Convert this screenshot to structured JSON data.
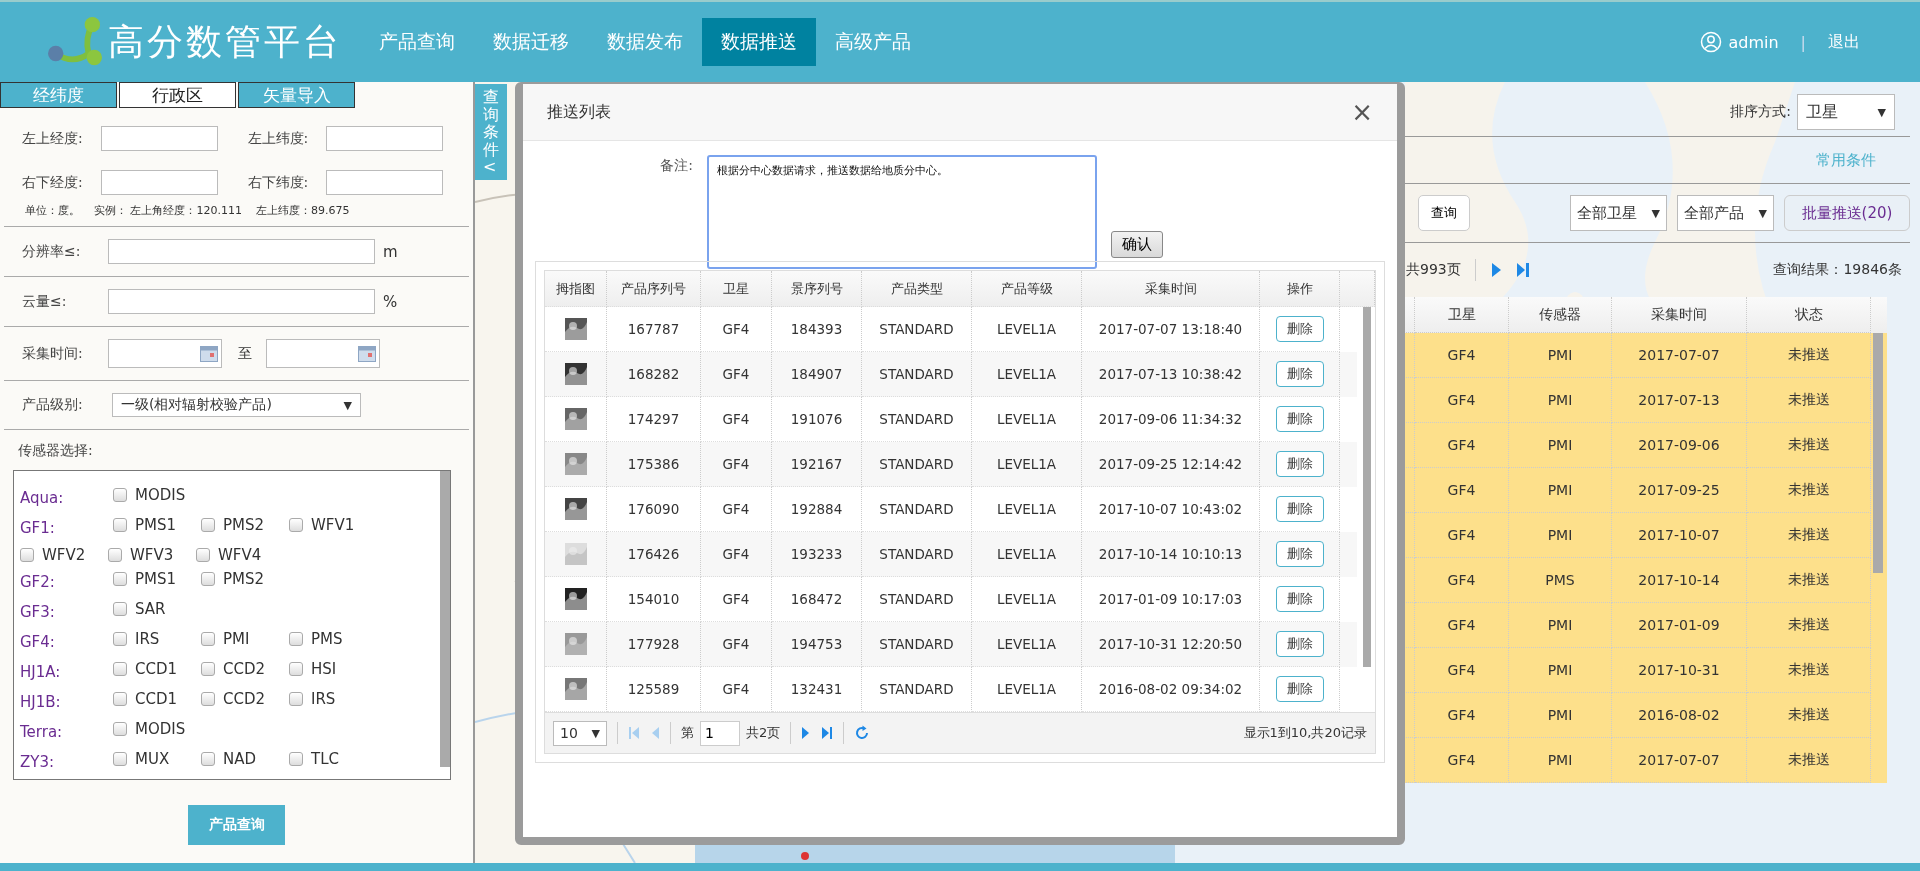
{
  "header": {
    "logo_text": "高分数管平台",
    "nav": [
      {
        "label": "产品查询",
        "selected": false
      },
      {
        "label": "数据迁移",
        "selected": false
      },
      {
        "label": "数据发布",
        "selected": false
      },
      {
        "label": "数据推送",
        "selected": true
      },
      {
        "label": "高级产品",
        "selected": false
      }
    ],
    "user": "admin",
    "separator": "|",
    "logout": "退出"
  },
  "left_panel": {
    "tabs": [
      {
        "label": "经纬度",
        "selected": false
      },
      {
        "label": "行政区",
        "selected": true
      },
      {
        "label": "矢量导入",
        "selected": false
      }
    ],
    "coord_fields": [
      {
        "label": "左上经度:"
      },
      {
        "label": "左上纬度:"
      },
      {
        "label": "右下经度:"
      },
      {
        "label": "右下纬度:"
      }
    ],
    "coord_hint": [
      "单位：度。",
      "实例： 左上角经度：120.111",
      "左上纬度：89.675"
    ],
    "resolution": {
      "label": "分辨率≤:",
      "unit": "m"
    },
    "cloud": {
      "label": "云量≤:",
      "unit": "%"
    },
    "time": {
      "label": "采集时间:",
      "to": "至"
    },
    "level": {
      "label": "产品级别:",
      "value": "一级(相对辐射校验产品)",
      "caret": "▼"
    },
    "sensors": {
      "label": "传感器选择:",
      "groups": [
        {
          "satellite": "Aqua:",
          "sensors": [
            {
              "name": "MODIS",
              "checked": false
            }
          ]
        },
        {
          "satellite": "GF1:",
          "sensors": [
            {
              "name": "PMS1",
              "checked": false
            },
            {
              "name": "PMS2",
              "checked": false
            },
            {
              "name": "WFV1",
              "checked": false
            },
            {
              "name": "WFV2",
              "checked": false
            },
            {
              "name": "WFV3",
              "checked": false
            },
            {
              "name": "WFV4",
              "checked": false
            }
          ]
        },
        {
          "satellite": "GF2:",
          "sensors": [
            {
              "name": "PMS1",
              "checked": false
            },
            {
              "name": "PMS2",
              "checked": false
            }
          ]
        },
        {
          "satellite": "GF3:",
          "sensors": [
            {
              "name": "SAR",
              "checked": false
            }
          ]
        },
        {
          "satellite": "GF4:",
          "sensors": [
            {
              "name": "IRS",
              "checked": false
            },
            {
              "name": "PMI",
              "checked": false
            },
            {
              "name": "PMS",
              "checked": false
            }
          ]
        },
        {
          "satellite": "HJ1A:",
          "sensors": [
            {
              "name": "CCD1",
              "checked": false
            },
            {
              "name": "CCD2",
              "checked": false
            },
            {
              "name": "HSI",
              "checked": false
            }
          ]
        },
        {
          "satellite": "HJ1B:",
          "sensors": [
            {
              "name": "CCD1",
              "checked": false
            },
            {
              "name": "CCD2",
              "checked": false
            },
            {
              "name": "IRS",
              "checked": false
            }
          ]
        },
        {
          "satellite": "Terra:",
          "sensors": [
            {
              "name": "MODIS",
              "checked": false
            }
          ]
        },
        {
          "satellite": "ZY3:",
          "sensors": [
            {
              "name": "MUX",
              "checked": false
            },
            {
              "name": "NAD",
              "checked": false
            },
            {
              "name": "TLC",
              "checked": false
            }
          ]
        }
      ]
    },
    "query_button": "产品查询"
  },
  "query_condition_tab": "查询条件<",
  "modal": {
    "title": "推送列表",
    "close": "×",
    "remark_label": "备注:",
    "remark": "根据分中心数据请求，推送数据给地质分中心。",
    "confirm": "确认",
    "table": {
      "columns": [
        "拇指图",
        "产品序列号",
        "卫星",
        "景序列号",
        "产品类型",
        "产品等级",
        "采集时间",
        "操作"
      ],
      "rows": [
        [
          "",
          "167787",
          "GF4",
          "184393",
          "STANDARD",
          "LEVEL1A",
          "2017-07-07 13:18:40",
          "删除"
        ],
        [
          "",
          "168282",
          "GF4",
          "184907",
          "STANDARD",
          "LEVEL1A",
          "2017-07-13 10:38:42",
          "删除"
        ],
        [
          "",
          "174297",
          "GF4",
          "191076",
          "STANDARD",
          "LEVEL1A",
          "2017-09-06 11:34:32",
          "删除"
        ],
        [
          "",
          "175386",
          "GF4",
          "192167",
          "STANDARD",
          "LEVEL1A",
          "2017-09-25 12:14:42",
          "删除"
        ],
        [
          "",
          "176090",
          "GF4",
          "192884",
          "STANDARD",
          "LEVEL1A",
          "2017-10-07 10:43:02",
          "删除"
        ],
        [
          "",
          "176426",
          "GF4",
          "193233",
          "STANDARD",
          "LEVEL1A",
          "2017-10-14 10:10:13",
          "删除"
        ],
        [
          "",
          "154010",
          "GF4",
          "168472",
          "STANDARD",
          "LEVEL1A",
          "2017-01-09 10:17:03",
          "删除"
        ],
        [
          "",
          "177928",
          "GF4",
          "194753",
          "STANDARD",
          "LEVEL1A",
          "2017-10-31 12:20:50",
          "删除"
        ],
        [
          "",
          "125589",
          "GF4",
          "132431",
          "STANDARD",
          "LEVEL1A",
          "2016-08-02 09:34:02",
          "删除"
        ]
      ]
    },
    "pagination": {
      "page_size": "10",
      "caret": "▼",
      "page_label": "第",
      "page": "1",
      "total_pages": "共2页",
      "summary": "显示1到10,共20记录",
      "nav": [
        {
          "kind": "first",
          "disabled": true
        },
        {
          "kind": "prev",
          "disabled": true
        },
        {
          "kind": "next",
          "disabled": false
        },
        {
          "kind": "last",
          "disabled": false
        }
      ]
    }
  },
  "right_panel": {
    "sort_label": "排序方式:",
    "sort_value": "卫星",
    "caret": "▼",
    "common_conditions": "常用条件",
    "query": "查询",
    "satellite_filter": "全部卫星",
    "product_filter": "全部产品",
    "batch_push": "批量推送(20)",
    "pages": "共993页",
    "result": "查询结果：19846条",
    "table": {
      "columns": [
        "卫星",
        "传感器",
        "采集时间",
        "状态"
      ],
      "rows": [
        {
          "cells": [
            "GF4",
            "PMI",
            "2017-07-07",
            "未推送"
          ],
          "selected": true
        },
        {
          "cells": [
            "GF4",
            "PMI",
            "2017-07-13",
            "未推送"
          ],
          "selected": true
        },
        {
          "cells": [
            "GF4",
            "PMI",
            "2017-09-06",
            "未推送"
          ],
          "selected": true
        },
        {
          "cells": [
            "GF4",
            "PMI",
            "2017-09-25",
            "未推送"
          ],
          "selected": true
        },
        {
          "cells": [
            "GF4",
            "PMI",
            "2017-10-07",
            "未推送"
          ],
          "selected": true
        },
        {
          "cells": [
            "GF4",
            "PMS",
            "2017-10-14",
            "未推送"
          ],
          "selected": true
        },
        {
          "cells": [
            "GF4",
            "PMI",
            "2017-01-09",
            "未推送"
          ],
          "selected": true
        },
        {
          "cells": [
            "GF4",
            "PMI",
            "2017-10-31",
            "未推送"
          ],
          "selected": true
        },
        {
          "cells": [
            "GF4",
            "PMI",
            "2016-08-02",
            "未推送"
          ],
          "selected": true
        },
        {
          "cells": [
            "GF4",
            "PMI",
            "2017-07-07",
            "未推送"
          ],
          "selected": true
        }
      ]
    }
  }
}
